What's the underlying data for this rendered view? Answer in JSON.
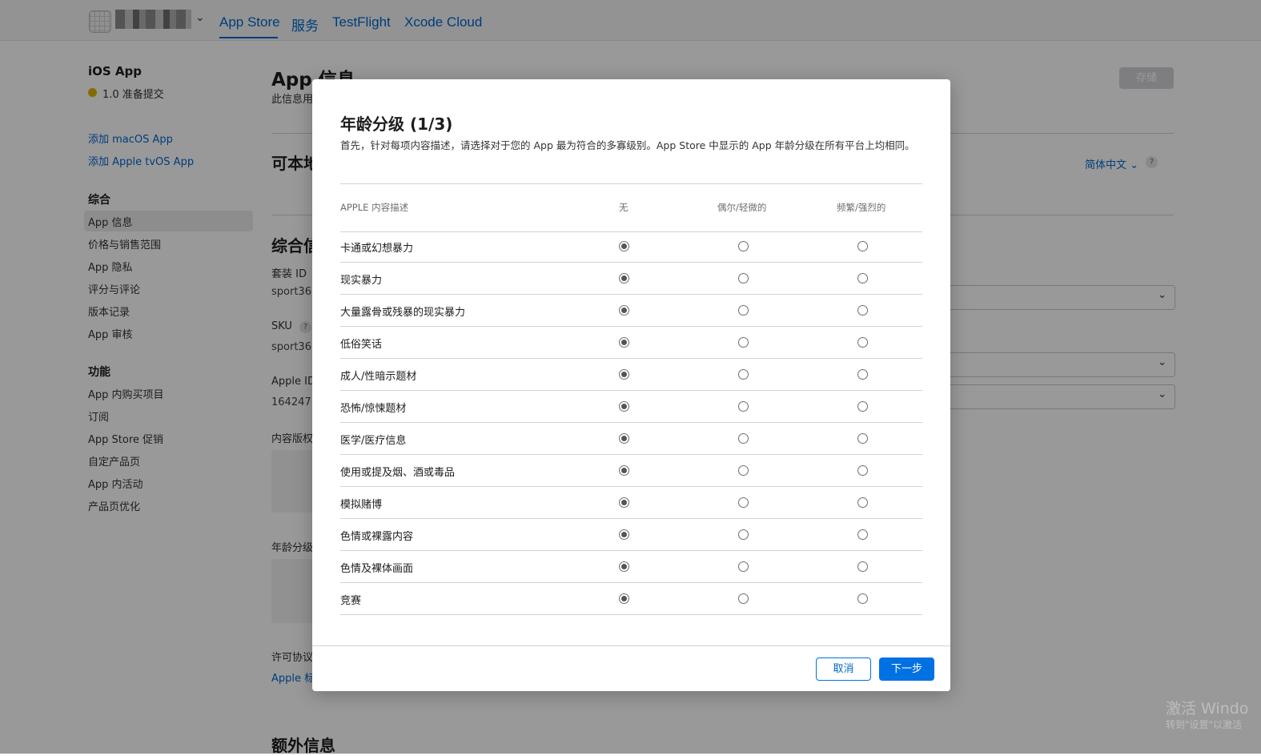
{
  "nav": {
    "tabs": [
      {
        "label": "App Store"
      },
      {
        "label": "服务"
      },
      {
        "label": "TestFlight"
      },
      {
        "label": "Xcode Cloud"
      }
    ],
    "chevron": "⌄"
  },
  "sidebar": {
    "app_title": "iOS App",
    "status": "1.0 准备提交",
    "add_links": [
      "添加 macOS App",
      "添加 Apple tvOS App"
    ],
    "section_general": "综合",
    "general_items": [
      "App 信息",
      "价格与销售范围",
      "App 隐私",
      "评分与评论",
      "版本记录",
      "App 审核"
    ],
    "section_features": "功能",
    "feature_items": [
      "App 内购买项目",
      "订阅",
      "App Store 促销",
      "自定产品页",
      "App 内活动",
      "产品页优化"
    ]
  },
  "main": {
    "title": "App 信息",
    "subtitle": "此信息用",
    "save": "存储",
    "localizable": "可本地",
    "language": "简体中文 ⌄",
    "help": "?",
    "general_info": "综合信",
    "bundle_id_label": "套装 ID",
    "bundle_id_value": "sport36",
    "sku_label": "SKU",
    "sku_value": "sport36",
    "apple_id_label": "Apple ID",
    "apple_id_value": "164247",
    "content_rights": "内容版权",
    "age_rating": "年龄分级",
    "license": "许可协议",
    "apple_link": "Apple 标",
    "extra_info": "额外信息"
  },
  "modal": {
    "title": "年龄分级 (1/3)",
    "description": "首先，针对每项内容描述，请选择对于您的 App 最为符合的多寡级别。App Store 中显示的 App 年龄分级在所有平台上均相同。",
    "columns": [
      "APPLE 内容描述",
      "无",
      "偶尔/轻微的",
      "频繁/强烈的"
    ],
    "rows": [
      {
        "label": "卡通或幻想暴力",
        "selected": "无"
      },
      {
        "label": "现实暴力",
        "selected": "无"
      },
      {
        "label": "大量露骨或残暴的现实暴力",
        "selected": "无"
      },
      {
        "label": "低俗笑话",
        "selected": "无"
      },
      {
        "label": "成人/性暗示题材",
        "selected": "无"
      },
      {
        "label": "恐怖/惊悚题材",
        "selected": "无"
      },
      {
        "label": "医学/医疗信息",
        "selected": "无"
      },
      {
        "label": "使用或提及烟、酒或毒品",
        "selected": "无"
      },
      {
        "label": "模拟赌博",
        "selected": "无"
      },
      {
        "label": "色情或裸露内容",
        "selected": "无"
      },
      {
        "label": "色情及裸体画面",
        "selected": "无"
      },
      {
        "label": "竞赛",
        "selected": "无"
      }
    ],
    "cancel": "取消",
    "next": "下一步"
  },
  "watermark": {
    "line1": "激活 Windo",
    "line2": "转到\"设置\"以激活"
  }
}
